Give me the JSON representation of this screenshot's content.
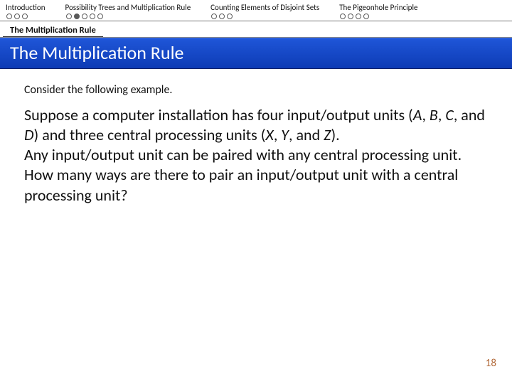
{
  "nav": {
    "sections": [
      {
        "label": "Introduction",
        "dots": [
          "o",
          "o",
          "o"
        ]
      },
      {
        "label": "Possibility Trees and Multiplication Rule",
        "dots": [
          "o",
          "f",
          "o",
          "o",
          "o"
        ]
      },
      {
        "label": "Counting Elements of Disjoint Sets",
        "dots": [
          "o",
          "o",
          "o"
        ]
      },
      {
        "label": "The Pigeonhole Principle",
        "dots": [
          "o",
          "o",
          "o",
          "o"
        ]
      }
    ]
  },
  "subsection": "The Multiplication Rule",
  "title": "The Multiplication Rule",
  "lead": "Consider the following example.",
  "body": {
    "p1a": "Suppose a computer installation has four input/output units (",
    "A": "A",
    "c1": ", ",
    "B": "B",
    "c2": ", ",
    "C": "C",
    "c3": ", and ",
    "D": "D",
    "p1b": ") and three central processing units (",
    "X": "X",
    "c4": ", ",
    "Y": "Y",
    "c5": ", and ",
    "Z": "Z",
    "p1c": ").",
    "p2": "Any input/output unit can be paired with any central processing unit. How many ways are there to pair an input/output unit with a central processing unit?"
  },
  "page": "18"
}
